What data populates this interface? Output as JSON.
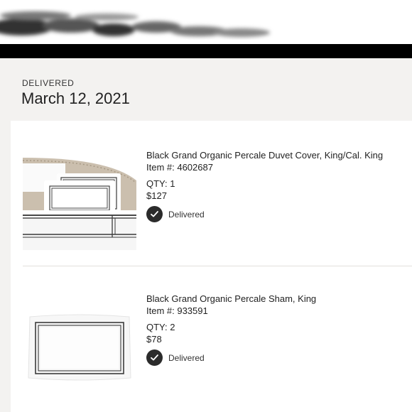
{
  "order": {
    "status_label": "DELIVERED",
    "date": "March 12, 2021"
  },
  "items": [
    {
      "name": "Black Grand Organic Percale Duvet Cover, King/Cal. King",
      "item_number": "Item #: 4602687",
      "qty": "QTY: 1",
      "price": "$127",
      "status": "Delivered",
      "image_icon": "bedding-photo"
    },
    {
      "name": "Black Grand Organic Percale Sham, King",
      "item_number": "Item #: 933591",
      "qty": "QTY: 2",
      "price": "$78",
      "status": "Delivered",
      "image_icon": "pillow-sham-photo"
    }
  ],
  "colors": {
    "header_bg": "#f3f2f0",
    "status_check": "#2b2b2b",
    "text": "#222222"
  }
}
